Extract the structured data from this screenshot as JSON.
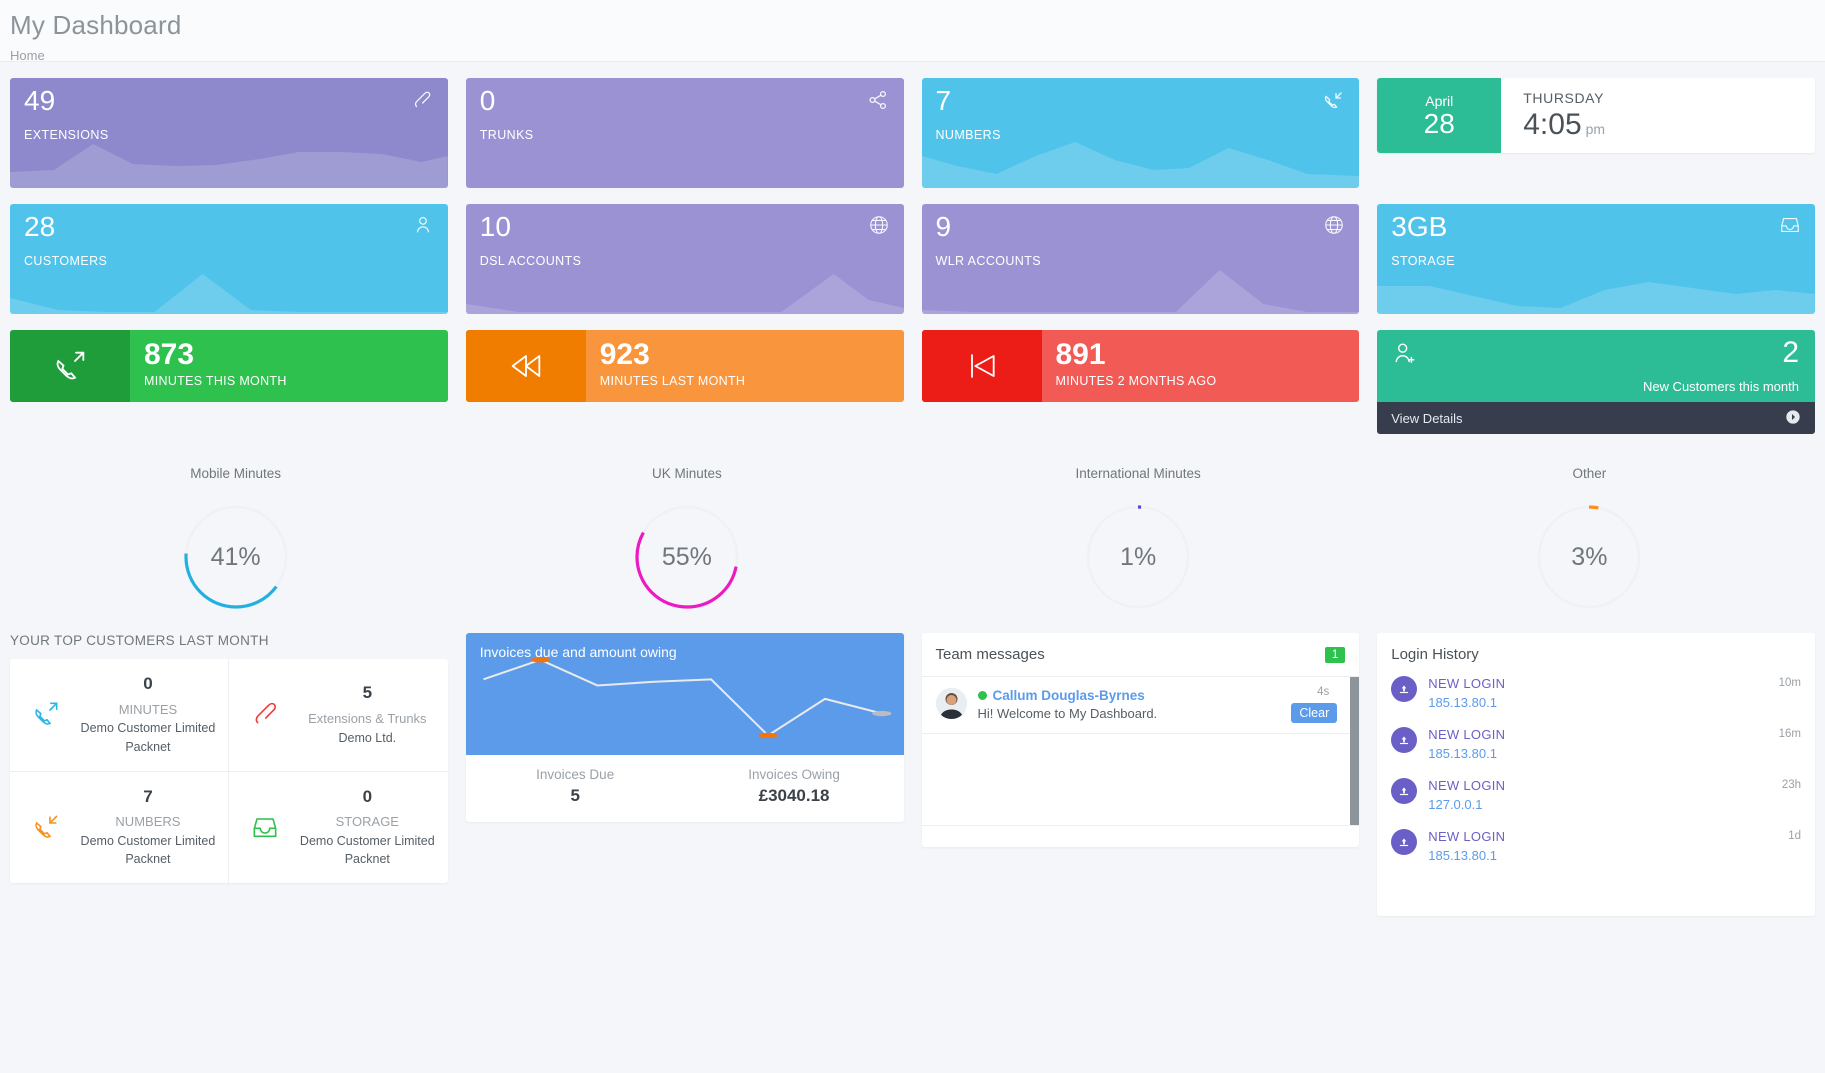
{
  "header": {
    "title": "My Dashboard",
    "breadcrumb": "Home"
  },
  "stats": [
    {
      "value": "49",
      "label": "EXTENSIONS",
      "icon": "phone-handset-icon",
      "theme": "purple",
      "spark": "0,46 10,44 19,18 28,38 38,40 47,39 57,33 66,26 76,26 85,28 94,36 100,30 100,62 0,62"
    },
    {
      "value": "0",
      "label": "TRUNKS",
      "icon": "share-icon",
      "theme": "purple2",
      "spark": "0,62 100,62"
    },
    {
      "value": "7",
      "label": "NUMBERS",
      "icon": "phone-incoming-icon",
      "theme": "cyan",
      "spark": "0,30 8,40 17,48 26,30 35,16 44,34 53,44 61,42 70,22 79,34 88,48 100,50 100,62 0,62"
    },
    {
      "value": "28",
      "label": "CUSTOMERS",
      "icon": "user-icon",
      "theme": "cyan",
      "spark": "0,46 11,58 22,60 33,60 44,22 55,58 66,60 78,60 89,60 100,60 100,62 0,62"
    },
    {
      "value": "10",
      "label": "DSL ACCOUNTS",
      "icon": "globe-icon",
      "theme": "purple2",
      "spark": "0,52 12,60 24,60 36,60 48,60 60,60 72,60 84,22 92,48 100,56 100,62 0,62"
    },
    {
      "value": "9",
      "label": "WLR ACCOUNTS",
      "icon": "globe-icon",
      "theme": "purple2",
      "spark": "0,58 12,60 24,60 36,60 48,60 58,60 68,18 78,52 88,60 100,60 100,62 0,62"
    },
    {
      "value": "3GB",
      "label": "STORAGE",
      "icon": "inbox-icon",
      "theme": "cyan",
      "spark": "0,34 12,34 22,44 32,54 42,56 52,38 62,30 72,36 82,42 91,38 100,42 100,62 0,62"
    }
  ],
  "date_widget": {
    "month": "April",
    "day": "28",
    "weekday": "THURSDAY",
    "time": "4:05",
    "ampm": "pm"
  },
  "minutes": [
    {
      "value": "873",
      "label": "MINUTES THIS MONTH",
      "theme": "mc-green",
      "icon": "phone-outgoing-icon"
    },
    {
      "value": "923",
      "label": "MINUTES LAST MONTH",
      "theme": "mc-orange",
      "icon": "rewind-icon"
    },
    {
      "value": "891",
      "label": "MINUTES 2 MONTHS AGO",
      "theme": "mc-red",
      "icon": "skip-back-icon"
    }
  ],
  "new_customers": {
    "count": "2",
    "caption": "New Customers this month",
    "footer_label": "View Details",
    "icon": "user-add-icon",
    "arrow": "arrow-right-circle-icon"
  },
  "chart_data": [
    {
      "type": "pie",
      "title": "Mobile Minutes",
      "values": [
        41
      ],
      "labels": [
        "41%"
      ],
      "color": "#22b0e0"
    },
    {
      "type": "pie",
      "title": "UK Minutes",
      "values": [
        55
      ],
      "labels": [
        "55%"
      ],
      "color": "#ec1ac4"
    },
    {
      "type": "pie",
      "title": "International Minutes",
      "values": [
        1
      ],
      "labels": [
        "1%"
      ],
      "color": "#5b45d6"
    },
    {
      "type": "pie",
      "title": "Other",
      "values": [
        3
      ],
      "labels": [
        "3%"
      ],
      "color": "#f89020"
    },
    {
      "type": "line",
      "title": "Invoices due and amount owing",
      "x": [
        0,
        1,
        2,
        3,
        4,
        5,
        6,
        7
      ],
      "values": [
        62,
        78,
        57,
        60,
        62,
        16,
        46,
        34
      ],
      "ylim": [
        0,
        100
      ],
      "grid": false,
      "markers": [
        {
          "x": 1,
          "color": "#f2740c"
        },
        {
          "x": 5,
          "color": "#f2740c"
        },
        {
          "x": 7,
          "color": "#b9bcc0"
        }
      ]
    }
  ],
  "donuts": [
    {
      "title": "Mobile Minutes",
      "percent": "41%",
      "value": 41,
      "color": "#22b0e0"
    },
    {
      "title": "UK Minutes",
      "percent": "55%",
      "value": 55,
      "color": "#ec1ac4"
    },
    {
      "title": "International Minutes",
      "percent": "1%",
      "value": 1,
      "color": "#5b45d6"
    },
    {
      "title": "Other",
      "percent": "3%",
      "value": 3,
      "color": "#f89020"
    }
  ],
  "top_customers": {
    "heading": "YOUR TOP CUSTOMERS LAST MONTH",
    "cells": [
      {
        "num": "0",
        "kind": "MINUTES",
        "customer": "Demo Customer Limited Packnet",
        "icon": "phone-outgoing-icon",
        "color": "#29b6e8"
      },
      {
        "num": "5",
        "kind": "Extensions & Trunks",
        "customer": "Demo Ltd.",
        "icon": "phone-handset-icon",
        "color": "#ef3b3b"
      },
      {
        "num": "7",
        "kind": "NUMBERS",
        "customer": "Demo Customer Limited Packnet",
        "icon": "phone-incoming-icon",
        "color": "#f89020"
      },
      {
        "num": "0",
        "kind": "STORAGE",
        "customer": "Demo Customer Limited Packnet",
        "icon": "inbox-icon",
        "color": "#2ec14e"
      }
    ]
  },
  "invoices": {
    "title": "Invoices due and amount owing",
    "due_label": "Invoices Due",
    "due_value": "5",
    "owing_label": "Invoices Owing",
    "owing_value": "£3040.18"
  },
  "team_messages": {
    "title": "Team messages",
    "badge": "1",
    "items": [
      {
        "name": "Callum Douglas-Byrnes",
        "text": "Hi! Welcome to My Dashboard.",
        "time": "4s",
        "clear_label": "Clear",
        "status": "online"
      }
    ]
  },
  "login_history": {
    "title": "Login History",
    "items": [
      {
        "event": "NEW LOGIN",
        "ip": "185.13.80.1",
        "time": "10m",
        "icon": "cloud-upload-icon"
      },
      {
        "event": "NEW LOGIN",
        "ip": "185.13.80.1",
        "time": "16m",
        "icon": "cloud-upload-icon"
      },
      {
        "event": "NEW LOGIN",
        "ip": "127.0.0.1",
        "time": "23h",
        "icon": "cloud-upload-icon"
      },
      {
        "event": "NEW LOGIN",
        "ip": "185.13.80.1",
        "time": "1d",
        "icon": "cloud-upload-icon"
      }
    ]
  }
}
